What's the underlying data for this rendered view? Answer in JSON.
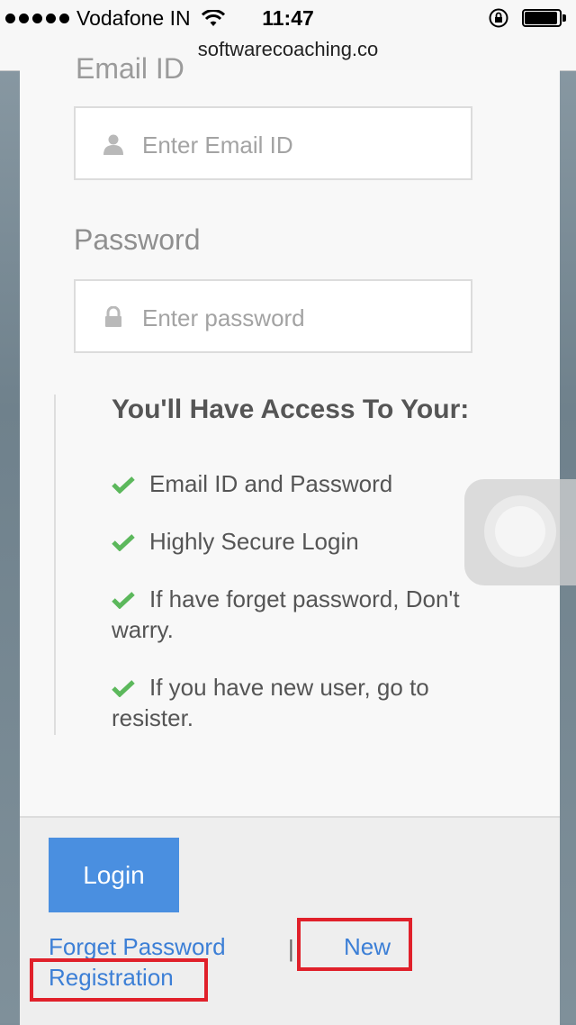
{
  "status_bar": {
    "carrier": "Vodafone IN",
    "time": "11:47"
  },
  "browser": {
    "url": "softwarecoaching.co"
  },
  "form": {
    "email_label_partial": "Email ID",
    "email_placeholder": "Enter Email ID",
    "password_label": "Password",
    "password_placeholder": "Enter password"
  },
  "access": {
    "title": "You'll Have Access To Your:",
    "items": [
      "Email ID and Password",
      "Highly Secure Login",
      "If have forget password, Don't warry.",
      "If you have new user, go to resister."
    ]
  },
  "footer": {
    "login_label": "Login",
    "forget_password": "Forget Password",
    "separator": "|",
    "new_label": "New",
    "registration_label": "Registration"
  },
  "colors": {
    "accent": "#4a8fe0",
    "link": "#3c7fd6",
    "check": "#5cb85c",
    "highlight": "#e0202a"
  }
}
